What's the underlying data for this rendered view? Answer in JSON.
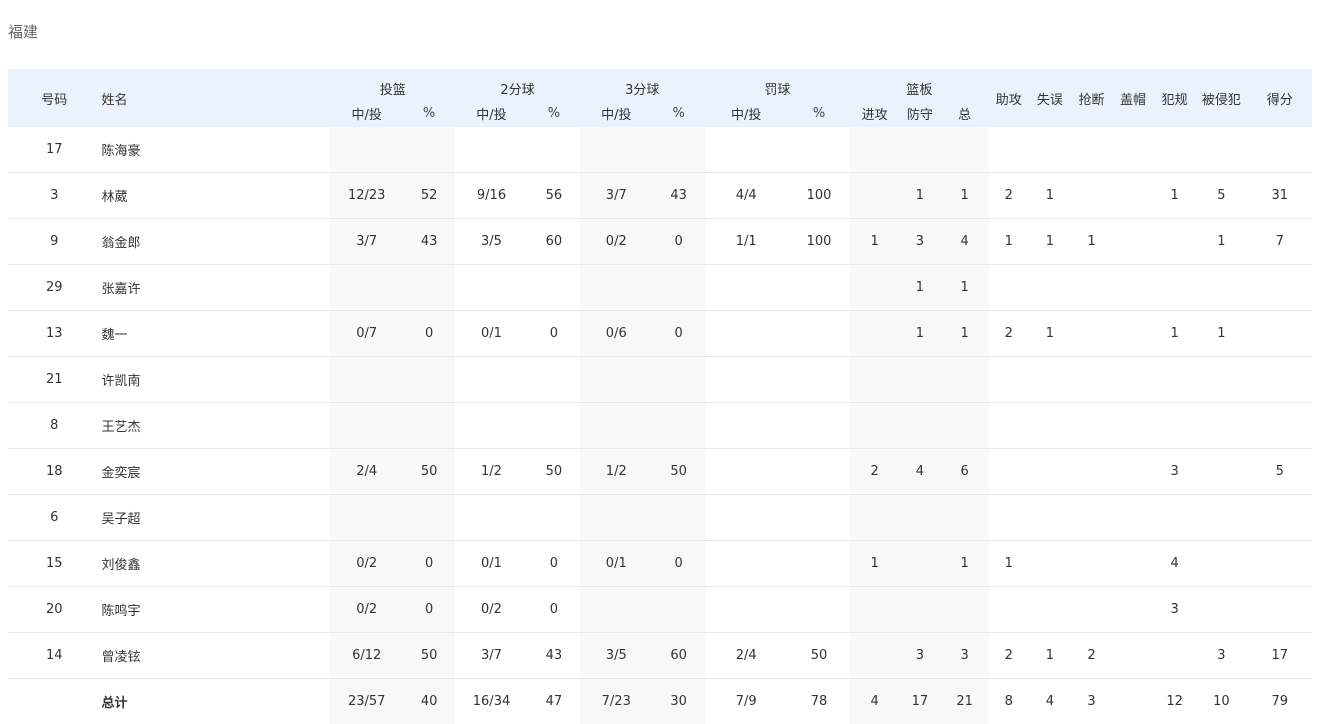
{
  "team": "福建",
  "header": {
    "number": "号码",
    "name": "姓名",
    "fg": "投篮",
    "two": "2分球",
    "three": "3分球",
    "ft": "罚球",
    "reb": "篮板",
    "made_att": "中/投",
    "pct": "%",
    "off": "进攻",
    "def": "防守",
    "tot": "总",
    "ast": "助攻",
    "tov": "失误",
    "stl": "抢断",
    "blk": "盖帽",
    "pf": "犯规",
    "fd": "被侵犯",
    "pts": "得分"
  },
  "rows": [
    {
      "no": "17",
      "name": "陈海豪",
      "fg": "",
      "fgp": "",
      "two": "",
      "twop": "",
      "three": "",
      "threep": "",
      "ft": "",
      "ftp": "",
      "off": "",
      "def": "",
      "reb": "",
      "ast": "",
      "tov": "",
      "stl": "",
      "blk": "",
      "pf": "",
      "fd": "",
      "pts": ""
    },
    {
      "no": "3",
      "name": "林葳",
      "fg": "12/23",
      "fgp": "52",
      "two": "9/16",
      "twop": "56",
      "three": "3/7",
      "threep": "43",
      "ft": "4/4",
      "ftp": "100",
      "off": "",
      "def": "1",
      "reb": "1",
      "ast": "2",
      "tov": "1",
      "stl": "",
      "blk": "",
      "pf": "1",
      "fd": "5",
      "pts": "31"
    },
    {
      "no": "9",
      "name": "翁金郎",
      "fg": "3/7",
      "fgp": "43",
      "two": "3/5",
      "twop": "60",
      "three": "0/2",
      "threep": "0",
      "ft": "1/1",
      "ftp": "100",
      "off": "1",
      "def": "3",
      "reb": "4",
      "ast": "1",
      "tov": "1",
      "stl": "1",
      "blk": "",
      "pf": "",
      "fd": "1",
      "pts": "7"
    },
    {
      "no": "29",
      "name": "张嘉许",
      "fg": "",
      "fgp": "",
      "two": "",
      "twop": "",
      "three": "",
      "threep": "",
      "ft": "",
      "ftp": "",
      "off": "",
      "def": "1",
      "reb": "1",
      "ast": "",
      "tov": "",
      "stl": "",
      "blk": "",
      "pf": "",
      "fd": "",
      "pts": ""
    },
    {
      "no": "13",
      "name": "魏一",
      "fg": "0/7",
      "fgp": "0",
      "two": "0/1",
      "twop": "0",
      "three": "0/6",
      "threep": "0",
      "ft": "",
      "ftp": "",
      "off": "",
      "def": "1",
      "reb": "1",
      "ast": "2",
      "tov": "1",
      "stl": "",
      "blk": "",
      "pf": "1",
      "fd": "1",
      "pts": ""
    },
    {
      "no": "21",
      "name": "许凯南",
      "fg": "",
      "fgp": "",
      "two": "",
      "twop": "",
      "three": "",
      "threep": "",
      "ft": "",
      "ftp": "",
      "off": "",
      "def": "",
      "reb": "",
      "ast": "",
      "tov": "",
      "stl": "",
      "blk": "",
      "pf": "",
      "fd": "",
      "pts": ""
    },
    {
      "no": "8",
      "name": "王艺杰",
      "fg": "",
      "fgp": "",
      "two": "",
      "twop": "",
      "three": "",
      "threep": "",
      "ft": "",
      "ftp": "",
      "off": "",
      "def": "",
      "reb": "",
      "ast": "",
      "tov": "",
      "stl": "",
      "blk": "",
      "pf": "",
      "fd": "",
      "pts": ""
    },
    {
      "no": "18",
      "name": "金奕宸",
      "fg": "2/4",
      "fgp": "50",
      "two": "1/2",
      "twop": "50",
      "three": "1/2",
      "threep": "50",
      "ft": "",
      "ftp": "",
      "off": "2",
      "def": "4",
      "reb": "6",
      "ast": "",
      "tov": "",
      "stl": "",
      "blk": "",
      "pf": "3",
      "fd": "",
      "pts": "5"
    },
    {
      "no": "6",
      "name": "吴子超",
      "fg": "",
      "fgp": "",
      "two": "",
      "twop": "",
      "three": "",
      "threep": "",
      "ft": "",
      "ftp": "",
      "off": "",
      "def": "",
      "reb": "",
      "ast": "",
      "tov": "",
      "stl": "",
      "blk": "",
      "pf": "",
      "fd": "",
      "pts": ""
    },
    {
      "no": "15",
      "name": "刘俊鑫",
      "fg": "0/2",
      "fgp": "0",
      "two": "0/1",
      "twop": "0",
      "three": "0/1",
      "threep": "0",
      "ft": "",
      "ftp": "",
      "off": "1",
      "def": "",
      "reb": "1",
      "ast": "1",
      "tov": "",
      "stl": "",
      "blk": "",
      "pf": "4",
      "fd": "",
      "pts": ""
    },
    {
      "no": "20",
      "name": "陈鸣宇",
      "fg": "0/2",
      "fgp": "0",
      "two": "0/2",
      "twop": "0",
      "three": "",
      "threep": "",
      "ft": "",
      "ftp": "",
      "off": "",
      "def": "",
      "reb": "",
      "ast": "",
      "tov": "",
      "stl": "",
      "blk": "",
      "pf": "3",
      "fd": "",
      "pts": ""
    },
    {
      "no": "14",
      "name": "曾凌铉",
      "fg": "6/12",
      "fgp": "50",
      "two": "3/7",
      "twop": "43",
      "three": "3/5",
      "threep": "60",
      "ft": "2/4",
      "ftp": "50",
      "off": "",
      "def": "3",
      "reb": "3",
      "ast": "2",
      "tov": "1",
      "stl": "2",
      "blk": "",
      "pf": "",
      "fd": "3",
      "pts": "17"
    }
  ],
  "total": {
    "no": "",
    "name": "总计",
    "fg": "23/57",
    "fgp": "40",
    "two": "16/34",
    "twop": "47",
    "three": "7/23",
    "threep": "30",
    "ft": "7/9",
    "ftp": "78",
    "off": "4",
    "def": "17",
    "reb": "21",
    "ast": "8",
    "tov": "4",
    "stl": "3",
    "blk": "",
    "pf": "12",
    "fd": "10",
    "pts": "79"
  }
}
